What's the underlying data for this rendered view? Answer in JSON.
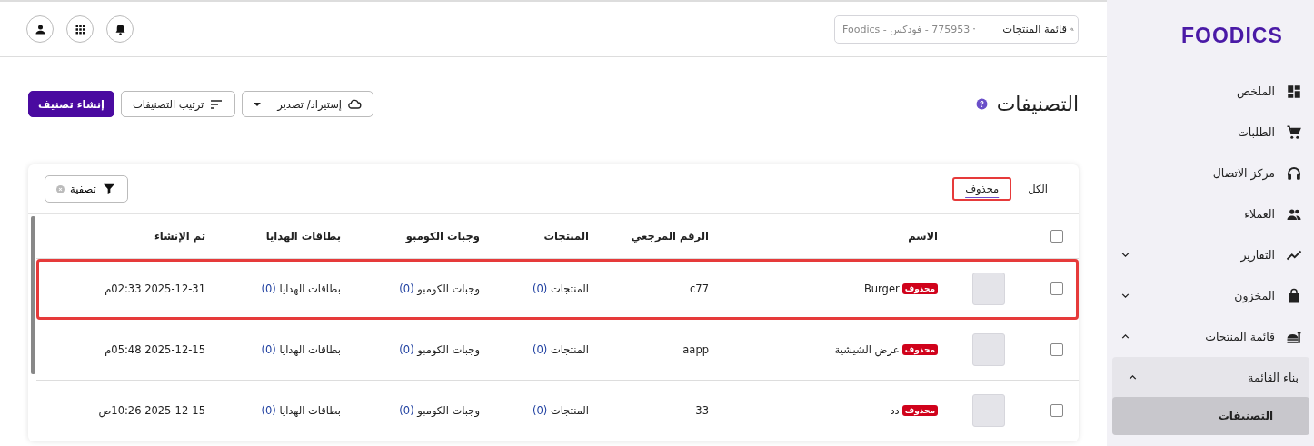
{
  "sidebar": {
    "logo": "FOODICS",
    "items": [
      {
        "label": "الملخص"
      },
      {
        "label": "الطلبات"
      },
      {
        "label": "مركز الاتصال"
      },
      {
        "label": "العملاء"
      },
      {
        "label": "التقارير",
        "expanded": false
      },
      {
        "label": "المخزون",
        "expanded": false
      },
      {
        "label": "قائمة المنتجات",
        "expanded": true,
        "children": [
          {
            "label": "بناء القائمة",
            "expanded": true,
            "children": [
              {
                "label": "التصنيفات",
                "selected": true
              }
            ]
          }
        ]
      }
    ]
  },
  "header": {
    "search": {
      "label": "قائمة المنتجات",
      "account": "775953 - فودكس - Foodics"
    }
  },
  "page": {
    "title": "التصنيفات",
    "buttons": [
      {
        "label": "إستيراد/ تصدير",
        "kind": "import"
      },
      {
        "label": "ترتيب التصنيفات",
        "kind": "sort"
      },
      {
        "label": "إنشاء تصنيف",
        "kind": "primary"
      }
    ]
  },
  "tabs": [
    {
      "label": "الكل",
      "selected": false,
      "highlighted": false
    },
    {
      "label": "محذوف",
      "selected": true,
      "highlighted": true
    }
  ],
  "filter": {
    "label": "تصفية"
  },
  "table": {
    "all_checked": false,
    "columns": [
      "الاسم",
      "الرقم المرجعي",
      "المنتجات",
      "وجبات الكومبو",
      "بطاقات الهدايا",
      "تم الإنشاء"
    ],
    "rows": [
      {
        "name": "Burger",
        "badge": "محذوف",
        "reference": "c77",
        "products": "المنتجات (0)",
        "combos": "وجبات الكومبو (0)",
        "gift_cards": "بطاقات الهدايا (0)",
        "created": "2025-12-31 02:33م",
        "highlighted": true,
        "checked": false
      },
      {
        "name": "عرض الشيشية",
        "badge": "محذوف",
        "reference": "aapp",
        "products": "المنتجات (0)",
        "combos": "وجبات الكومبو (0)",
        "gift_cards": "بطاقات الهدايا (0)",
        "created": "2025-12-15 05:48م",
        "highlighted": false,
        "checked": false
      },
      {
        "name": "دد",
        "badge": "محذوف",
        "reference": "33",
        "products": "المنتجات (0)",
        "combos": "وجبات الكومبو (0)",
        "gift_cards": "بطاقات الهدايا (0)",
        "created": "2025-12-15 10:26ص",
        "highlighted": false,
        "checked": false
      }
    ]
  }
}
